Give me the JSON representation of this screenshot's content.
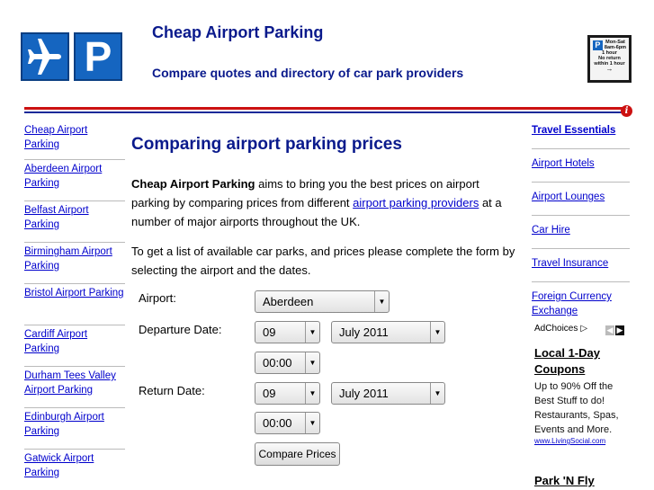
{
  "header": {
    "logo_letter": "P",
    "title": "Cheap Airport Parking",
    "tagline": "Compare quotes and directory of car park providers",
    "sign_lines": [
      "Mon-Sat",
      "8am-6pm",
      "1 hour",
      "No return",
      "within 1 hour",
      "→"
    ]
  },
  "left_nav": {
    "items": [
      "Cheap Airport Parking",
      "Aberdeen Airport Parking",
      "Belfast Airport Parking",
      "Birmingham Airport Parking",
      "Bristol Airport Parking",
      "Cardiff Airport Parking",
      "Durham Tees Valley Airport Parking",
      "Edinburgh Airport Parking",
      "Gatwick Airport Parking"
    ]
  },
  "main": {
    "heading": "Comparing airport parking prices",
    "intro_bold": "Cheap Airport Parking",
    "intro_1": " aims to bring you the best prices on airport parking by comparing prices from different ",
    "intro_link": "airport parking providers",
    "intro_2": " at a number of major airports throughout the UK.",
    "para2": "To get a list of available car parks, and prices please complete the form by selecting the airport and the dates."
  },
  "form": {
    "airport_label": "Airport:",
    "airport_value": "Aberdeen",
    "departure_label": "Departure Date:",
    "departure_day": "09",
    "departure_month": "July 2011",
    "departure_time": "00:00",
    "return_label": "Return Date:",
    "return_day": "09",
    "return_month": "July 2011",
    "return_time": "00:00",
    "submit_label": "Compare Prices"
  },
  "right_nav": {
    "items": [
      "Travel Essentials",
      "Airport Hotels",
      "Airport Lounges",
      "Car Hire",
      "Travel Insurance",
      "Foreign Currency Exchange"
    ]
  },
  "ad": {
    "choices_label": "AdChoices",
    "title": "Local 1-Day Coupons",
    "body": "Up to 90% Off the Best Stuff to do! Restaurants, Spas, Events and More.",
    "url": "www.LivingSocial.com",
    "title2": "Park 'N Fly"
  },
  "colors": {
    "brand_blue": "#1565c0",
    "heading_navy": "#0a1a8c",
    "rule_red": "#cc1111",
    "link": "#0000cc"
  }
}
